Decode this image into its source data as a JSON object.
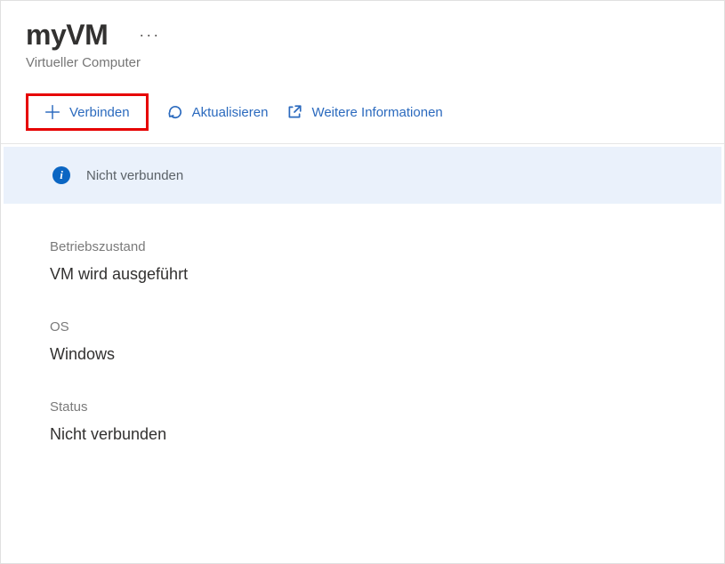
{
  "header": {
    "title": "myVM",
    "subtitle": "Virtueller Computer"
  },
  "toolbar": {
    "connect_label": "Verbinden",
    "refresh_label": "Aktualisieren",
    "more_info_label": "Weitere Informationen"
  },
  "banner": {
    "status_text": "Nicht verbunden"
  },
  "details": {
    "operational_state": {
      "label": "Betriebszustand",
      "value": "VM wird ausgeführt"
    },
    "os": {
      "label": "OS",
      "value": "Windows"
    },
    "status": {
      "label": "Status",
      "value": "Nicht verbunden"
    }
  },
  "colors": {
    "accent": "#2b6abe",
    "highlight_border": "#e60000",
    "banner_bg": "#eaf1fb",
    "info_icon_bg": "#0b66c3"
  }
}
